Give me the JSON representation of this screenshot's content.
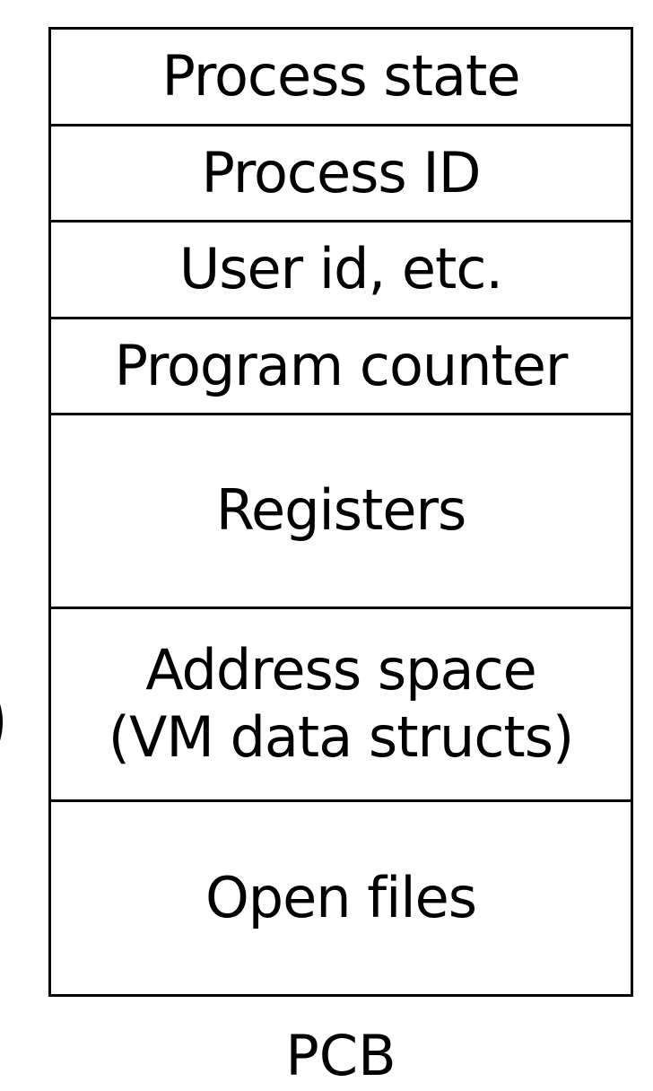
{
  "pcb": {
    "fields": [
      {
        "label": "Process state"
      },
      {
        "label": "Process ID"
      },
      {
        "label": "User id, etc."
      },
      {
        "label": "Program counter"
      },
      {
        "label": "Registers"
      },
      {
        "label_line1": "Address space",
        "label_line2": "(VM data structs)"
      },
      {
        "label": "Open files"
      }
    ],
    "caption": "PCB"
  },
  "colors": {
    "border": "#000000",
    "text": "#000000",
    "background": "#ffffff"
  }
}
